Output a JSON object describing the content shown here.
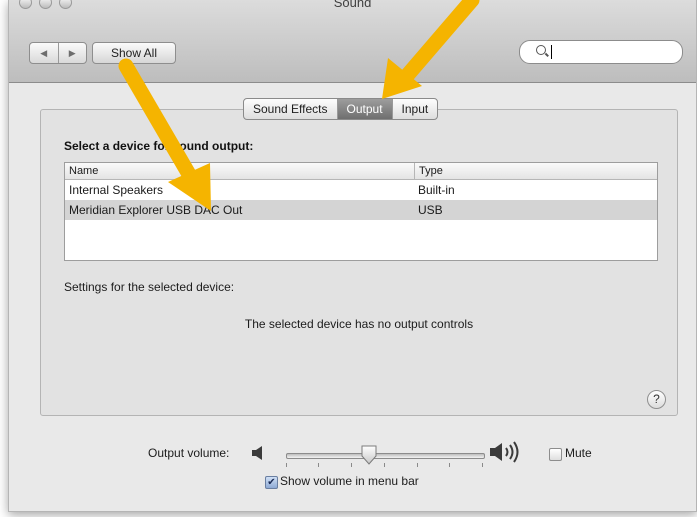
{
  "window": {
    "title": "Sound",
    "nav": {
      "back_icon": "◀",
      "forward_icon": "▶"
    },
    "show_all_label": "Show All",
    "search": {
      "value": "",
      "icon": "search-icon"
    }
  },
  "tabs": [
    {
      "label": "Sound Effects",
      "active": false
    },
    {
      "label": "Output",
      "active": true
    },
    {
      "label": "Input",
      "active": false
    }
  ],
  "output": {
    "select_label": "Select a device for sound output:",
    "columns": [
      "Name",
      "Type"
    ],
    "devices": [
      {
        "name": "Internal Speakers",
        "type": "Built-in",
        "selected": false
      },
      {
        "name": "Meridian Explorer USB DAC Out",
        "type": "USB",
        "selected": true
      }
    ],
    "settings_label": "Settings for the selected device:",
    "no_controls_message": "The selected device has no output controls",
    "help_label": "?"
  },
  "volume": {
    "label": "Output volume:",
    "level": 0.42,
    "mute_label": "Mute",
    "muted": false,
    "show_in_menu_bar_label": "Show volume in menu bar",
    "show_in_menu_bar": true
  },
  "colors": {
    "annotation_arrow": "#f5b400",
    "active_tab": "#7f7f7f",
    "selected_row": "#d4d4d4"
  }
}
